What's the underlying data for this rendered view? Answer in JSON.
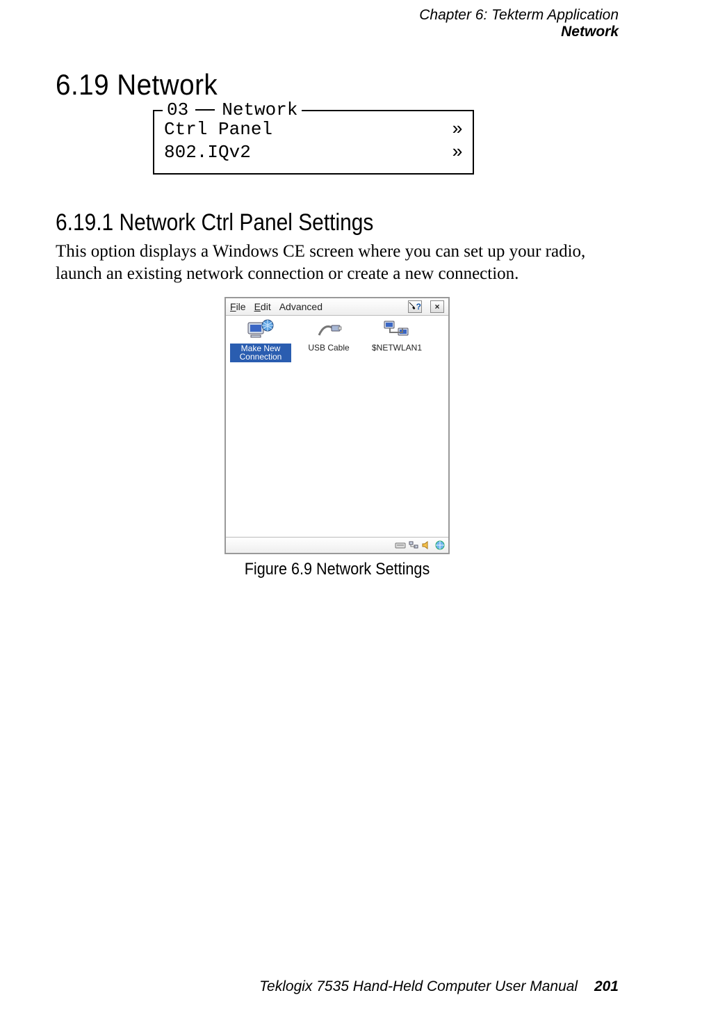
{
  "header": {
    "chapter_line": "Chapter  6:   Tekterm Application",
    "section_word": "Network"
  },
  "h1": "6.19   Network",
  "terminal": {
    "legend_num": "03",
    "legend_word": "Network",
    "rows": [
      {
        "label": "Ctrl Panel",
        "arrow": "»"
      },
      {
        "label": "802.IQv2",
        "arrow": "»"
      }
    ]
  },
  "h2": "6.19.1   Network Ctrl Panel Settings",
  "paragraph": "This option displays a Windows CE screen where you can set up your radio, launch an existing network connection or create a new connection.",
  "ce": {
    "menu": {
      "file": "File",
      "edit": "Edit",
      "advanced": "Advanced"
    },
    "help_icon": "?",
    "close_icon": "×",
    "items": [
      {
        "caption": "Make New Connection",
        "selected": true,
        "icon": "globe"
      },
      {
        "caption": "USB Cable",
        "selected": false,
        "icon": "usb"
      },
      {
        "caption": "$NETWLAN1",
        "selected": false,
        "icon": "net"
      }
    ]
  },
  "figure_caption": "Figure 6.9 Network Settings",
  "footer": {
    "book": "Teklogix 7535 Hand-Held Computer User Manual",
    "page": "201"
  }
}
